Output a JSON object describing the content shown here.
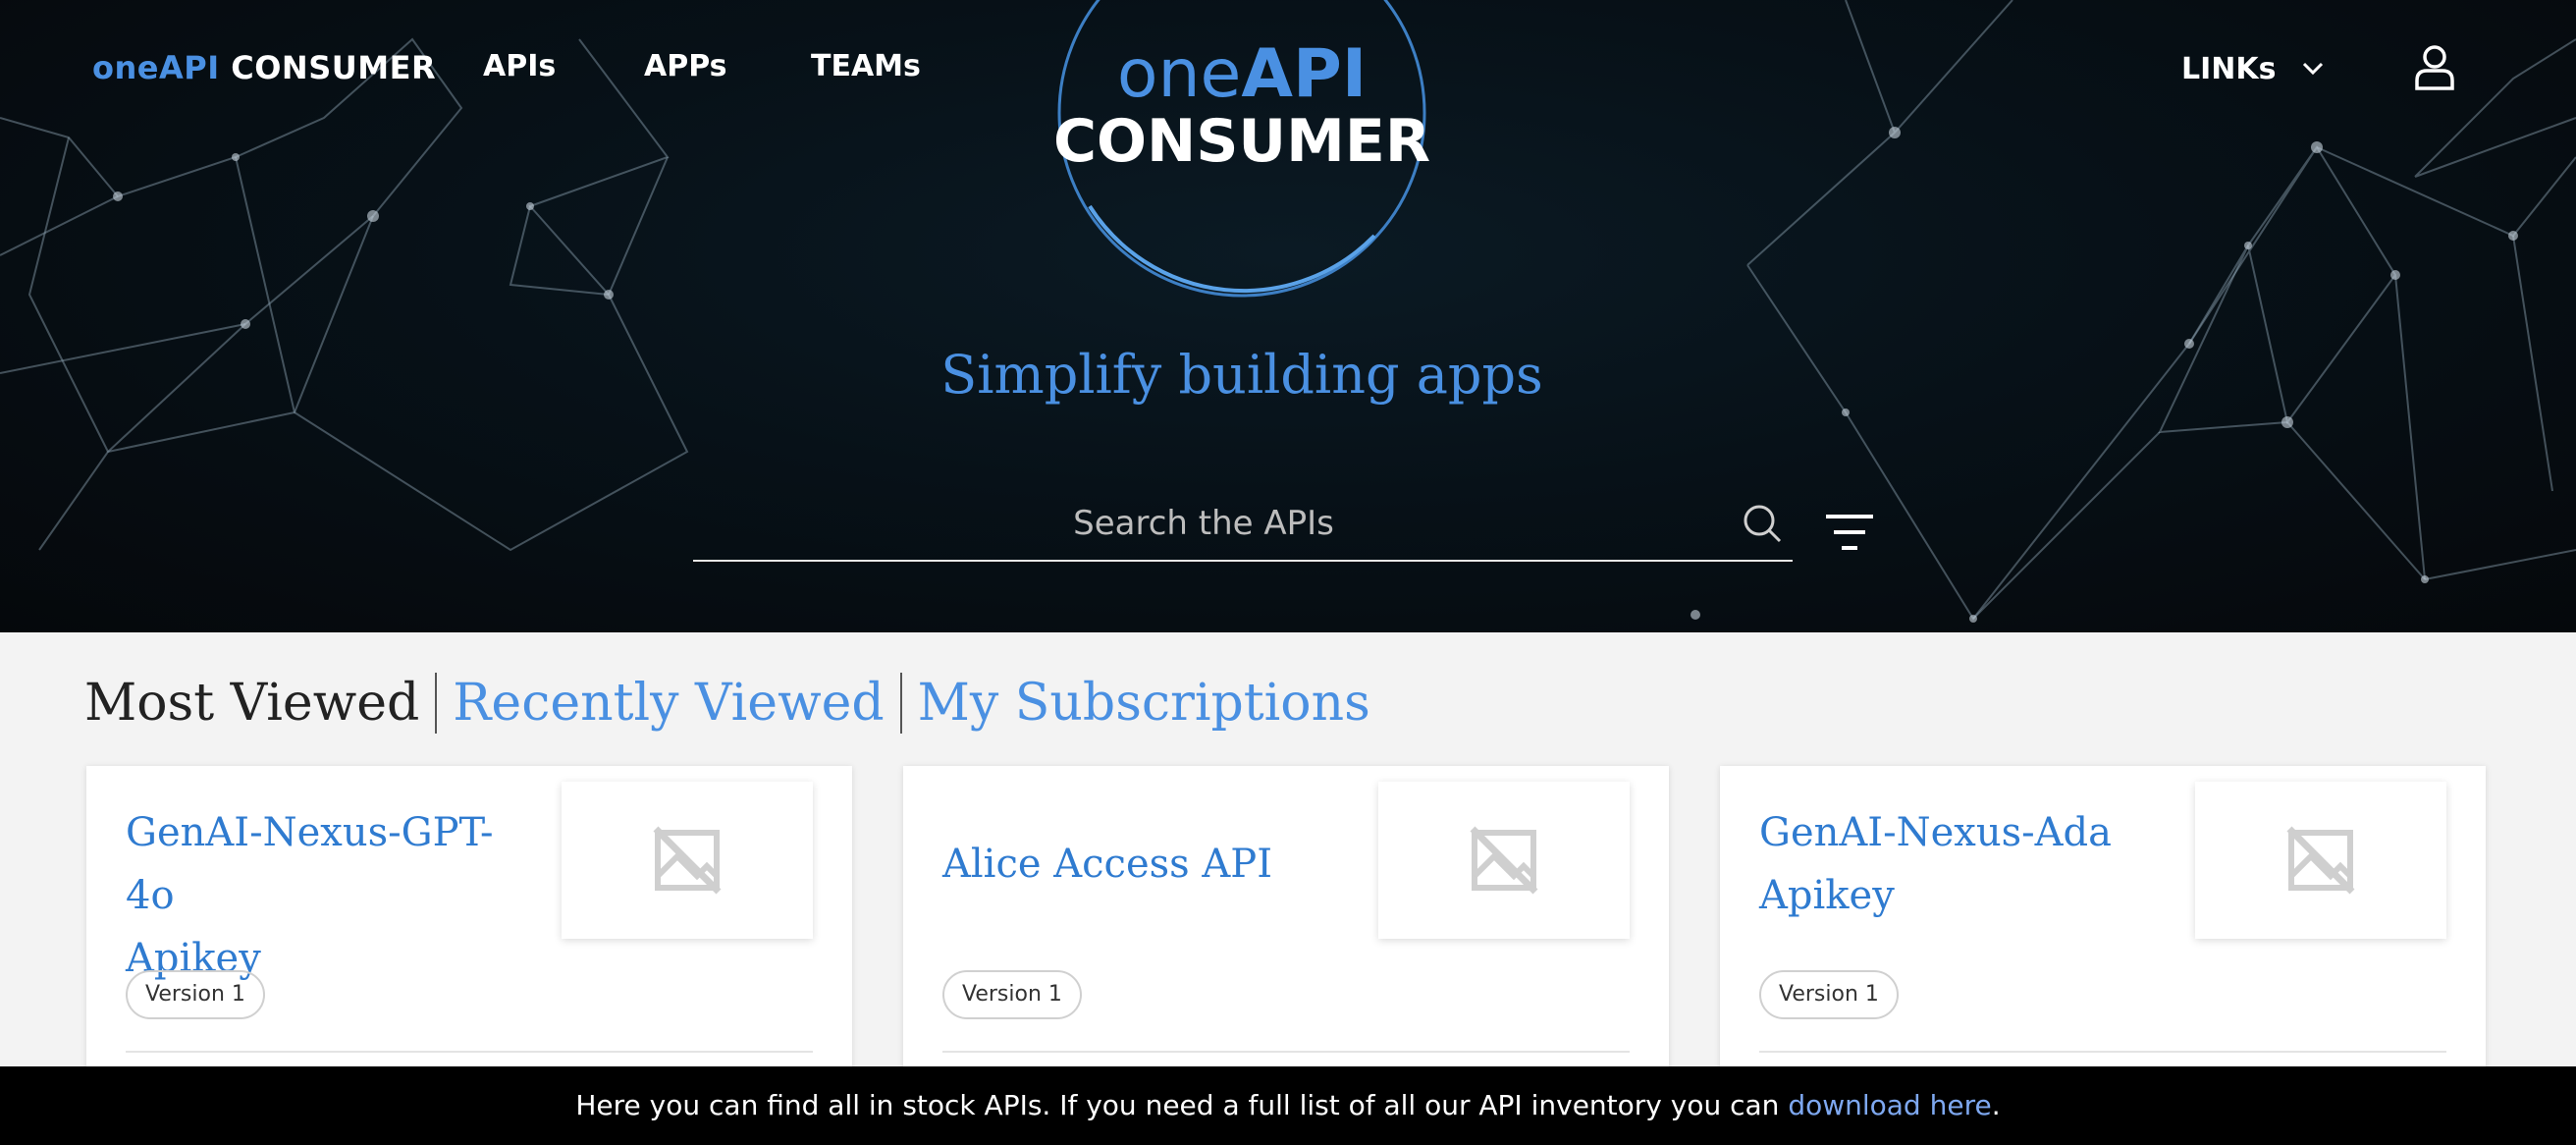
{
  "header": {
    "brand_accent": "oneAPI",
    "brand_main": "CONSUMER",
    "nav": [
      {
        "label": "APIs"
      },
      {
        "label": "APPs"
      },
      {
        "label": "TEAMs"
      }
    ],
    "links_label": "LINKs",
    "user_icon": "user-icon"
  },
  "logo": {
    "line1_light": "one",
    "line1_bold": "API",
    "line2": "CONSUMER"
  },
  "hero": {
    "tagline": "Simplify building apps",
    "search_placeholder": "Search the APIs",
    "search_icon": "search-icon",
    "filter_icon": "filter-icon"
  },
  "tabs": [
    {
      "label": "Most Viewed",
      "active": true
    },
    {
      "label": "Recently Viewed",
      "active": false
    },
    {
      "label": "My Subscriptions",
      "active": false
    }
  ],
  "cards": [
    {
      "title_line1": "GenAI-Nexus-GPT-4o",
      "title_line2": "Apikey",
      "version": "Version 1",
      "thumb_icon": "image-unavailable-icon"
    },
    {
      "title_line1": "Alice Access API",
      "title_line2": "",
      "version": "Version 1",
      "thumb_icon": "image-unavailable-icon"
    },
    {
      "title_line1": "GenAI-Nexus-Ada",
      "title_line2": "Apikey",
      "version": "Version 1",
      "thumb_icon": "image-unavailable-icon"
    }
  ],
  "info_bar": {
    "text": "Here you can find all in stock APIs. If you need a full list of all our API inventory you can ",
    "link_label": "download here",
    "suffix": "."
  },
  "colors": {
    "accent": "#4a90e2",
    "card_title": "#2f7bd0",
    "hero_bg": "#071118",
    "page_bg": "#f3f3f3",
    "info_bar_bg": "#000000"
  }
}
